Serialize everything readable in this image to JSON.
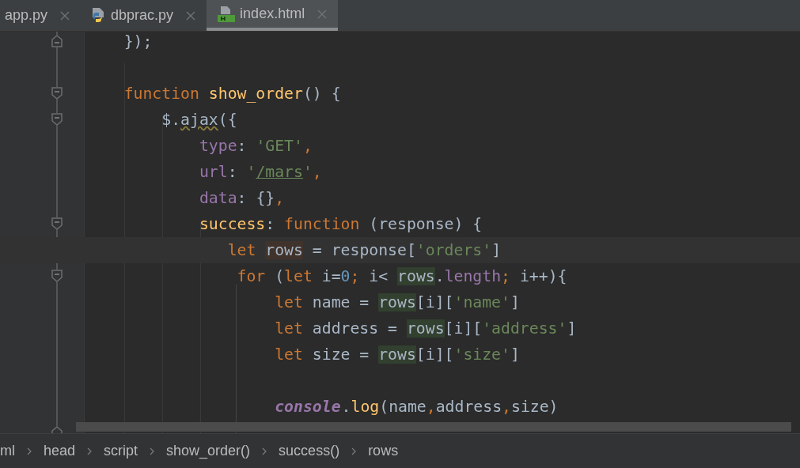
{
  "tabs": [
    {
      "label": "app.py",
      "kind": "plain",
      "selected": false
    },
    {
      "label": "dbprac.py",
      "kind": "python",
      "selected": false
    },
    {
      "label": "index.html",
      "kind": "html",
      "selected": true
    }
  ],
  "editor": {
    "lines": [
      {
        "kind": "fold_end",
        "current": false,
        "tokens": [
          {
            "kind": "plain",
            "text": "    });"
          }
        ]
      },
      {
        "kind": "plain",
        "current": false
      },
      {
        "kind": "fold_start",
        "current": false,
        "tokens": [
          {
            "kind": "keyword",
            "text": "    function "
          },
          {
            "kind": "function",
            "text": "show_order"
          },
          {
            "kind": "plain",
            "text": "() {"
          }
        ]
      },
      {
        "kind": "fold_start",
        "current": false,
        "tokens": [
          {
            "kind": "plain",
            "text": "        $."
          },
          {
            "kind": "warning",
            "text": "ajax"
          },
          {
            "kind": "plain",
            "text": "({"
          }
        ]
      },
      {
        "kind": "plain",
        "current": false,
        "tokens": [
          {
            "kind": "property",
            "text": "            type"
          },
          {
            "kind": "plain",
            "text": ": "
          },
          {
            "kind": "string",
            "text": "'GET'"
          },
          {
            "kind": "keyword",
            "text": ","
          }
        ]
      },
      {
        "kind": "plain",
        "current": false,
        "tokens": [
          {
            "kind": "property",
            "text": "            url"
          },
          {
            "kind": "plain",
            "text": ": "
          },
          {
            "kind": "string",
            "text": "'"
          },
          {
            "kind": "string_link",
            "text": "/mars"
          },
          {
            "kind": "string",
            "text": "'"
          },
          {
            "kind": "keyword",
            "text": ","
          }
        ]
      },
      {
        "kind": "plain",
        "current": false,
        "tokens": [
          {
            "kind": "property",
            "text": "            data"
          },
          {
            "kind": "plain",
            "text": ": {}"
          },
          {
            "kind": "keyword",
            "text": ","
          }
        ]
      },
      {
        "kind": "fold_start",
        "current": false,
        "tokens": [
          {
            "kind": "function",
            "text": "            success"
          },
          {
            "kind": "plain",
            "text": ": "
          },
          {
            "kind": "keyword",
            "text": "function "
          },
          {
            "kind": "plain",
            "text": "(response) {"
          }
        ]
      },
      {
        "kind": "plain",
        "current": true,
        "tokens": [
          {
            "kind": "keyword",
            "text": "               let "
          },
          {
            "kind": "ident_write",
            "text": "rows"
          },
          {
            "kind": "plain",
            "text": " = response["
          },
          {
            "kind": "string",
            "text": "'orders'"
          },
          {
            "kind": "plain",
            "text": "]"
          }
        ]
      },
      {
        "kind": "fold_start",
        "current": false,
        "tokens": [
          {
            "kind": "keyword",
            "text": "                for "
          },
          {
            "kind": "plain",
            "text": "("
          },
          {
            "kind": "keyword",
            "text": "let "
          },
          {
            "kind": "plain",
            "text": "i="
          },
          {
            "kind": "number",
            "text": "0"
          },
          {
            "kind": "keyword",
            "text": "; "
          },
          {
            "kind": "plain",
            "text": "i< "
          },
          {
            "kind": "ident_read",
            "text": "rows"
          },
          {
            "kind": "plain",
            "text": "."
          },
          {
            "kind": "property",
            "text": "length"
          },
          {
            "kind": "keyword",
            "text": "; "
          },
          {
            "kind": "plain",
            "text": "i++){"
          }
        ]
      },
      {
        "kind": "plain",
        "current": false,
        "tokens": [
          {
            "kind": "keyword",
            "text": "                    let "
          },
          {
            "kind": "plain",
            "text": "name = "
          },
          {
            "kind": "ident_read",
            "text": "rows"
          },
          {
            "kind": "plain",
            "text": "[i]["
          },
          {
            "kind": "string",
            "text": "'name'"
          },
          {
            "kind": "plain",
            "text": "]"
          }
        ]
      },
      {
        "kind": "plain",
        "current": false,
        "tokens": [
          {
            "kind": "keyword",
            "text": "                    let "
          },
          {
            "kind": "plain",
            "text": "address = "
          },
          {
            "kind": "ident_read",
            "text": "rows"
          },
          {
            "kind": "plain",
            "text": "[i]["
          },
          {
            "kind": "string",
            "text": "'address'"
          },
          {
            "kind": "plain",
            "text": "]"
          }
        ]
      },
      {
        "kind": "plain",
        "current": false,
        "tokens": [
          {
            "kind": "keyword",
            "text": "                    let "
          },
          {
            "kind": "plain",
            "text": "size = "
          },
          {
            "kind": "ident_read",
            "text": "rows"
          },
          {
            "kind": "plain",
            "text": "[i]["
          },
          {
            "kind": "string",
            "text": "'size'"
          },
          {
            "kind": "plain",
            "text": "]"
          }
        ]
      },
      {
        "kind": "plain",
        "current": false
      },
      {
        "kind": "plain",
        "current": false,
        "tokens": [
          {
            "kind": "global",
            "text": "                    console"
          },
          {
            "kind": "method",
            "text": ".log"
          },
          {
            "kind": "plain",
            "text": "(name"
          },
          {
            "kind": "separated",
            "text": ",address"
          },
          {
            "kind": "separated",
            "text": ",size)"
          }
        ]
      },
      {
        "kind": "fold_end",
        "current": false
      }
    ]
  },
  "breadcrumbs": [
    "ml",
    "head",
    "script",
    "show_order()",
    "success()",
    "rows"
  ]
}
